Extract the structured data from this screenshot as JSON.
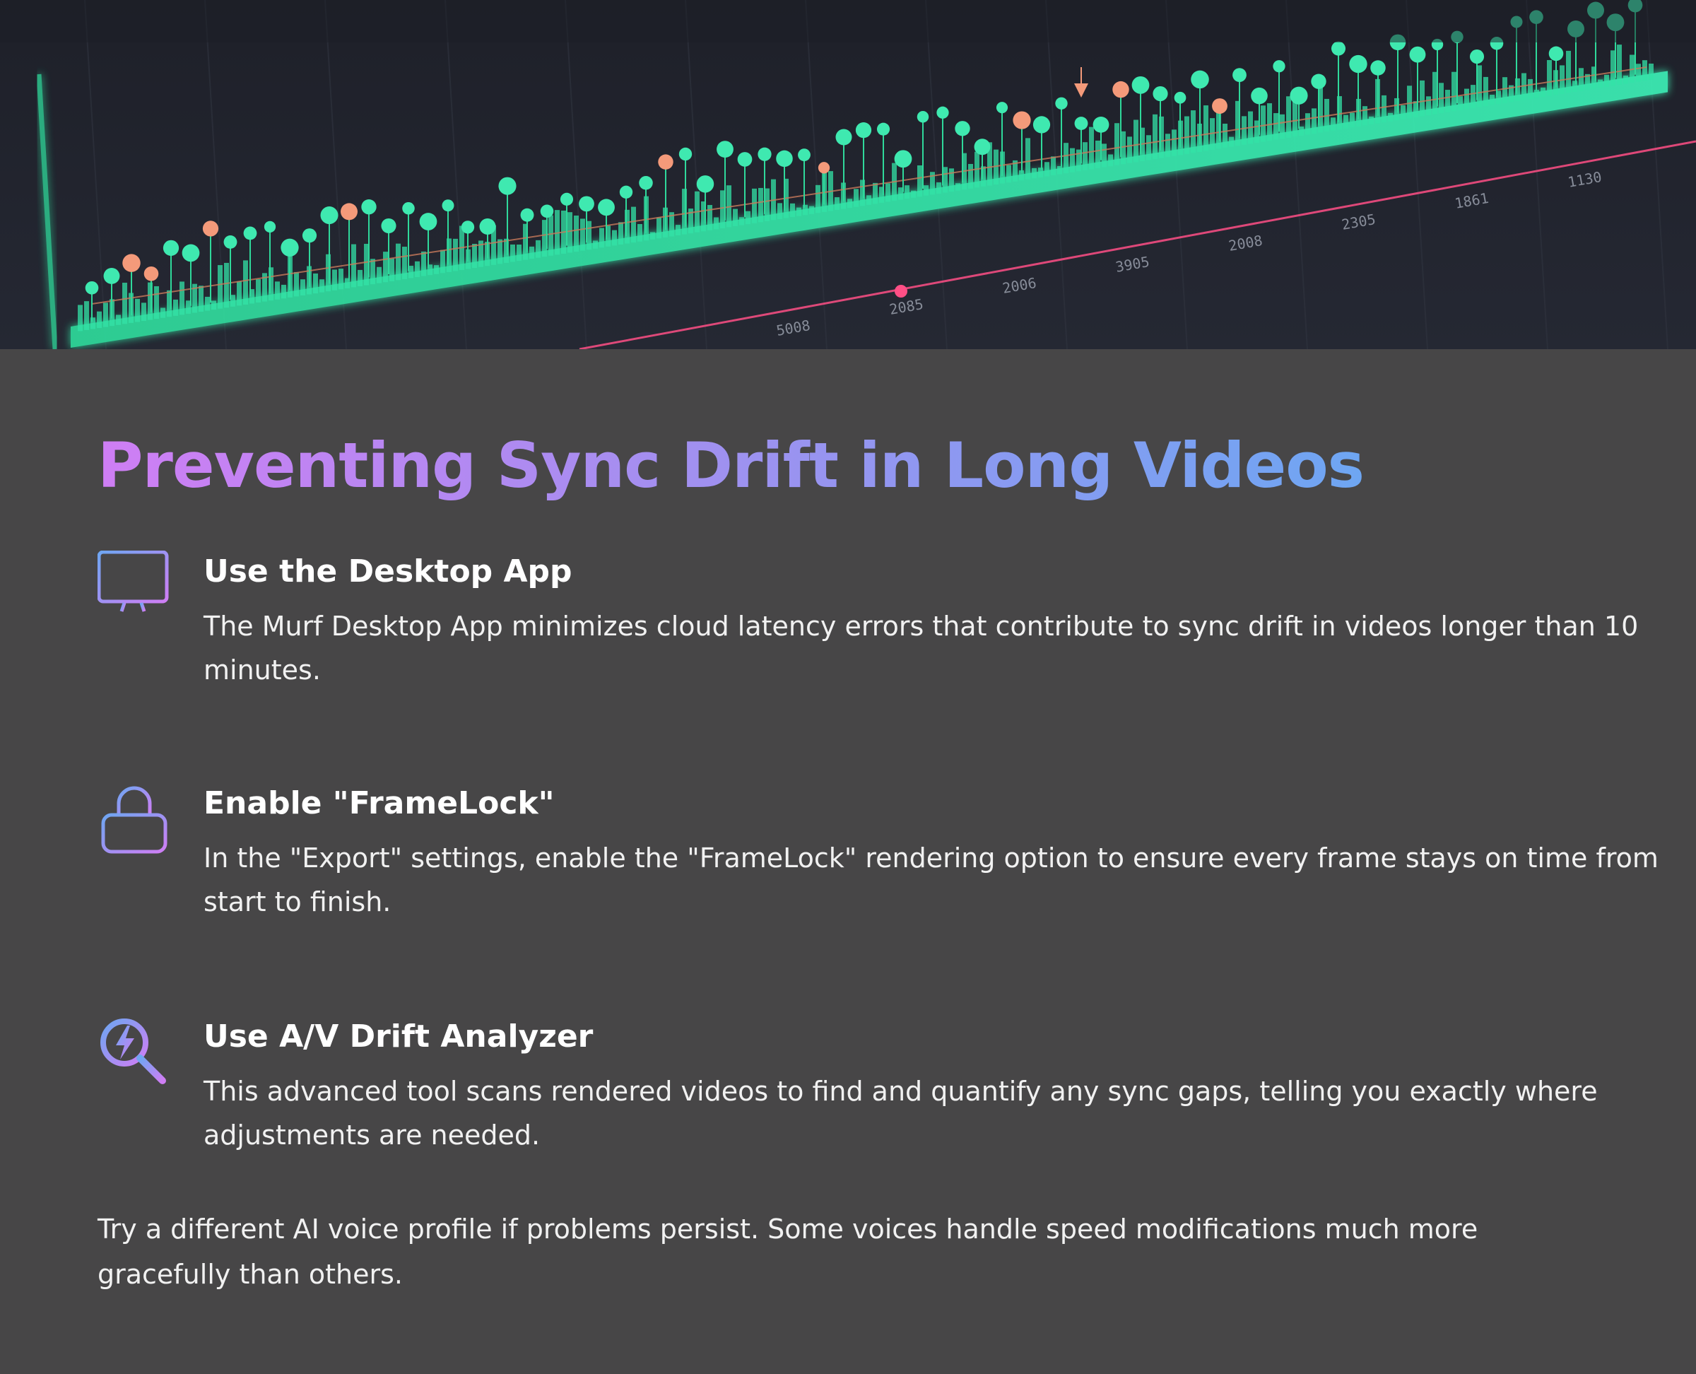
{
  "title": "Preventing Sync Drift in Long Videos",
  "items": [
    {
      "icon": "desktop-monitor-icon",
      "heading": "Use the Desktop App",
      "text": "The Murf Desktop App minimizes cloud latency errors that contribute to sync drift in videos longer than 10 minutes."
    },
    {
      "icon": "lock-icon",
      "heading": "Enable \"FrameLock\"",
      "text": "In the \"Export\" settings, enable the \"FrameLock\" rendering option to ensure every frame stays on time from start to finish."
    },
    {
      "icon": "magnifier-lightning-icon",
      "heading": "Use A/V Drift Analyzer",
      "text": "This advanced tool scans rendered videos to find and quantify any sync gaps, telling you exactly where adjustments are needed."
    }
  ],
  "footer_note": "Try a different AI voice profile if problems persist. Some voices handle speed modifications much more gracefully than others.",
  "colors": {
    "background": "#474647",
    "title_gradient_start": "#cf7ef4",
    "title_gradient_end": "#6ea6f2",
    "waveform": "#2ee6a6",
    "marker": "#f49a7a",
    "timeline_line": "#ff4f86"
  }
}
